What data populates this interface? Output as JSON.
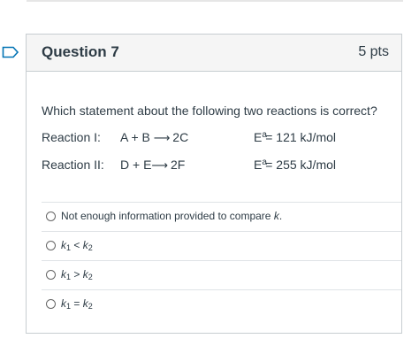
{
  "question": {
    "title": "Question 7",
    "points": "5 pts",
    "stem": "Which statement about the following two reactions is correct?"
  },
  "reactions": [
    {
      "label": "Reaction I:",
      "lhs": "A + B",
      "rhs": "2C",
      "ea_symbol": "E",
      "ea_sub": "a",
      "ea_value": "= 121 kJ/mol"
    },
    {
      "label": "Reaction II:",
      "lhs": "D + E",
      "rhs": "2F",
      "ea_symbol": "E",
      "ea_sub": "a",
      "ea_value": "= 255 kJ/mol"
    }
  ],
  "answers": [
    {
      "text": "Not enough information provided to compare ",
      "var": "k",
      "tail": "."
    },
    {
      "k1": "k",
      "k1_sub": "1",
      "op": " < ",
      "k2": "k",
      "k2_sub": "2"
    },
    {
      "k1": "k",
      "k1_sub": "1",
      "op": " > ",
      "k2": "k",
      "k2_sub": "2"
    },
    {
      "k1": "k",
      "k1_sub": "1",
      "op": " = ",
      "k2": "k",
      "k2_sub": "2"
    }
  ],
  "arrow_glyph": "⟶",
  "flag_icon": "bookmark-flag-icon",
  "colors": {
    "accent": "#0374b5",
    "text": "#2d3b45",
    "header_bg": "#f5f5f5",
    "border": "#c7cdd1"
  }
}
